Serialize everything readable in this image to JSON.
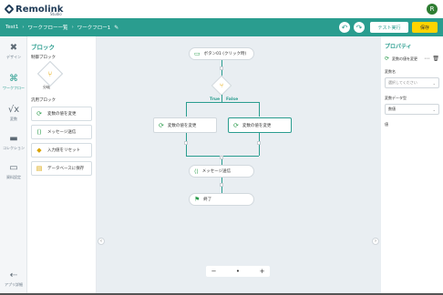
{
  "app": {
    "logo_text": "Remolink",
    "logo_sub": "Studio",
    "avatar_initial": "R",
    "breadcrumb": [
      "Test1",
      "ワークフロー一覧",
      "ワークフロー1"
    ],
    "test_label": "テスト実行",
    "save_label": "保存"
  },
  "leftnav": [
    {
      "label": "デザイン",
      "icon": "design-icon"
    },
    {
      "label": "ワークフロー",
      "icon": "workflow-icon",
      "active": true
    },
    {
      "label": "変数",
      "icon": "variable-icon"
    },
    {
      "label": "コレクション",
      "icon": "collection-icon"
    },
    {
      "label": "資料設定",
      "icon": "folder-icon"
    },
    {
      "label": "アプリ詳細",
      "icon": "back-arrow-icon"
    }
  ],
  "blockpanel": {
    "title": "ブロック",
    "control_title": "制御ブロック",
    "condition_label": "分岐",
    "general_title": "汎用ブロック",
    "blocks": [
      {
        "label": "変数の値を変更",
        "icon": "refresh-icon",
        "color": "#2e9d4f"
      },
      {
        "label": "メッセージ送信",
        "icon": "message-icon",
        "color": "#2e9d4f"
      },
      {
        "label": "入力値をリセット",
        "icon": "reset-icon",
        "color": "#d9a300"
      },
      {
        "label": "データベースに保存",
        "icon": "database-icon",
        "color": "#d9a300"
      }
    ]
  },
  "canvas": {
    "trigger_label": "ボタン01 (クリック時)",
    "true_label": "True",
    "false_label": "False",
    "branch_left_label": "変数の値を変更",
    "branch_right_label": "変数の値を変更",
    "message_label": "メッセージ送信",
    "end_label": "終了"
  },
  "props": {
    "title": "プロパティ",
    "block_name": "変数の値を変更",
    "var_label": "変数名",
    "var_placeholder": "選択してください",
    "type_label": "変数データ型",
    "type_value": "数値",
    "value_label": "値"
  },
  "colors": {
    "accent": "#2a9d8f",
    "save": "#ffd400"
  }
}
